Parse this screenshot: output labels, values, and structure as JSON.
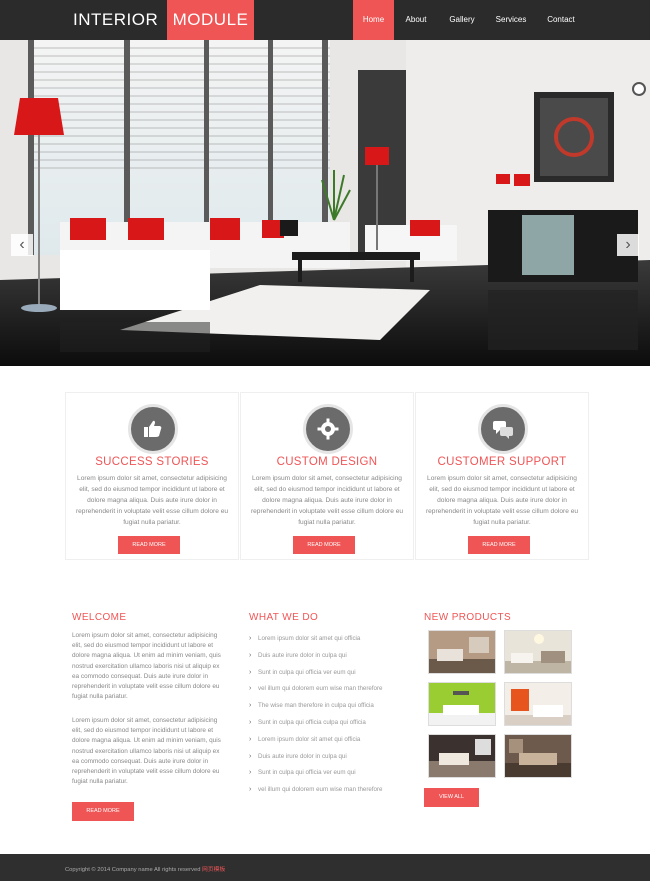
{
  "header": {
    "logo_part1": "INTERIOR",
    "logo_part2": "MODULE",
    "nav": [
      "Home",
      "About",
      "Gallery",
      "Services",
      "Contact"
    ],
    "active_nav": "Home"
  },
  "hero": {
    "prev_icon": "chevron-left-icon",
    "next_icon": "chevron-right-icon",
    "pause_icon": "pause-icon"
  },
  "features": [
    {
      "icon": "thumbs-up-icon",
      "title": "SUCCESS STORIES",
      "text": "Lorem ipsum dolor sit amet, consectetur adipisicing elit, sed do eiusmod tempor incididunt ut labore et dolore magna aliqua. Duis aute irure dolor in reprehenderit in voluptate velit esse cillum dolore eu fugiat nulla pariatur.",
      "button": "READ MORE"
    },
    {
      "icon": "gear-icon",
      "title": "CUSTOM DESIGN",
      "text": "Lorem ipsum dolor sit amet, consectetur adipisicing elit, sed do eiusmod tempor incididunt ut labore et dolore magna aliqua. Duis aute irure dolor in reprehenderit in voluptate velit esse cillum dolore eu fugiat nulla pariatur.",
      "button": "READ MORE"
    },
    {
      "icon": "chat-bubbles-icon",
      "title": "CUSTOMER SUPPORT",
      "text": "Lorem ipsum dolor sit amet, consectetur adipisicing elit, sed do eiusmod tempor incididunt ut labore et dolore magna aliqua. Duis aute irure dolor in reprehenderit in voluptate velit esse cillum dolore eu fugiat nulla pariatur.",
      "button": "READ MORE"
    }
  ],
  "welcome": {
    "title": "WELCOME",
    "para1": "Lorem ipsum dolor sit amet, consectetur adipisicing elit, sed do eiusmod tempor incididunt ut labore et dolore magna aliqua. Ut enim ad minim veniam, quis nostrud exercitation ullamco laboris nisi ut aliquip ex ea commodo consequat. Duis aute irure dolor in reprehenderit in voluptate velit esse cillum dolore eu fugiat nulla pariatur.",
    "para2": "Lorem ipsum dolor sit amet, consectetur adipisicing elit, sed do eiusmod tempor incididunt ut labore et dolore magna aliqua. Ut enim ad minim veniam, quis nostrud exercitation ullamco laboris nisi ut aliquip ex ea commodo consequat. Duis aute irure dolor in reprehenderit in voluptate velit esse cillum dolore eu fugiat nulla pariatur.",
    "button": "READ MORE"
  },
  "what_we_do": {
    "title": "WHAT WE DO",
    "items": [
      "Lorem ipsum dolor sit amet qui officia",
      "Duis aute irure dolor in culpa qui",
      "Sunt in culpa qui officia ver eum qui",
      "vel illum qui dolorem eum wise man therefore",
      "The wise man therefore in culpa qui officia",
      "Sunt in culpa qui officia culpa qui officia",
      "Lorem ipsum dolor sit amet qui officia",
      "Duis aute irure dolor in culpa qui",
      "Sunt in culpa qui officia ver eum qui",
      "vel illum qui dolorem eum wise man therefore"
    ]
  },
  "new_products": {
    "title": "NEW PRODUCTS",
    "button": "VIEW ALL"
  },
  "footer": {
    "text": "Copyright © 2014 Company name All rights reserved",
    "link": "网页模板"
  },
  "colors": {
    "accent": "#f05556",
    "header_bg": "#2b2b2b",
    "footer_bg": "#2f2f2f"
  }
}
